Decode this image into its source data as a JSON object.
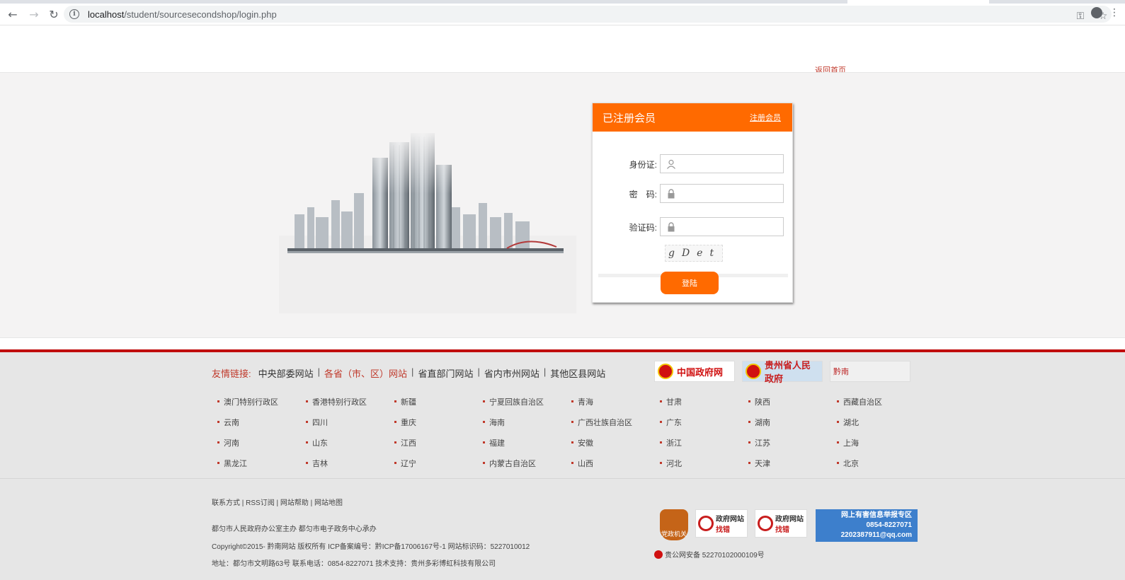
{
  "browser": {
    "url_host": "localhost",
    "url_path": "/student/sourcesecondshop/login.php"
  },
  "header": {
    "home_link": "返回首页"
  },
  "login": {
    "title": "已注册会员",
    "register_link": "注册会员",
    "id_label": "身份证:",
    "password_label": "密　码:",
    "captcha_label": "验证码:",
    "captcha_text": "gDet",
    "submit_label": "登陆"
  },
  "friend_links": {
    "lead": "友情链接:",
    "items": [
      "中央部委网站",
      "各省（市、区）网站",
      "省直部门网站",
      "省内市州网站",
      "其他区县网站"
    ]
  },
  "badges": {
    "gov": "中国政府网",
    "guizhou": "贵州省人民政府",
    "qiannan": "黔南"
  },
  "regions": [
    "澳门特别行政区",
    "香港特别行政区",
    "新疆",
    "宁夏回族自治区",
    "青海",
    "甘肃",
    "陕西",
    "西藏自治区",
    "云南",
    "四川",
    "重庆",
    "海南",
    "广西壮族自治区",
    "广东",
    "湖南",
    "湖北",
    "河南",
    "山东",
    "江西",
    "福建",
    "安徽",
    "浙江",
    "江苏",
    "上海",
    "黑龙江",
    "吉林",
    "辽宁",
    "内蒙古自治区",
    "山西",
    "河北",
    "天津",
    "北京"
  ],
  "footer": {
    "nav": "联系方式 | RSS订阅 | 网站帮助 | 网站地图",
    "host": "都匀市人民政府办公室主办 都匀市电子政务中心承办",
    "copyright": "Copyright©2015- 黔南网站 版权所有 ICP备案编号：黔ICP备17006167号-1 网站标识码：5227010012",
    "address": "地址：都匀市文明路63号 联系电话：0854-8227071 技术支持：贵州多彩博虹科技有限公司",
    "police": "贵公网安备 52270102000109号",
    "shield_text": "党政机关",
    "error_label_1": "政府网站",
    "error_label_2": "找错",
    "report_title": "网上有害信息举报专区",
    "report_phone": "0854-8227071",
    "report_email": "2202387911@qq.com"
  }
}
